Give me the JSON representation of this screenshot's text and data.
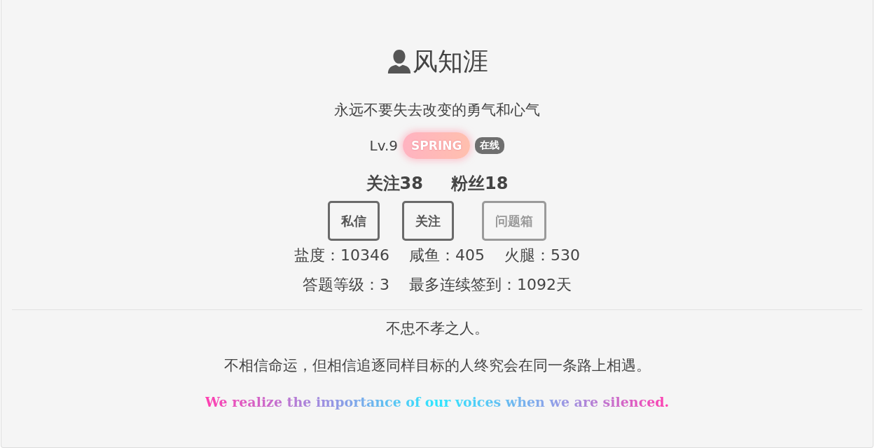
{
  "profile": {
    "name": "风知涯",
    "motto": "永远不要失去改变的勇气和心气",
    "level": "Lv.9",
    "badge": "SPRING",
    "status": "在线"
  },
  "counts": [
    {
      "label": "关注38"
    },
    {
      "label": "粉丝18"
    }
  ],
  "buttons": [
    {
      "label": "私信",
      "disabled": false
    },
    {
      "label": "关注",
      "disabled": false
    },
    {
      "label": "问题箱",
      "disabled": true
    }
  ],
  "stats": [
    [
      "盐度：10346",
      "咸鱼：405",
      "火腿：530"
    ],
    [
      "答题等级：3",
      "最多连续签到：1092天"
    ]
  ],
  "bio": [
    "不忠不孝之人。",
    "不相信命运，但相信追逐同样目标的人终究会在同一条路上相遇。"
  ],
  "quote": "We realize the importance of our voices when we are silenced."
}
